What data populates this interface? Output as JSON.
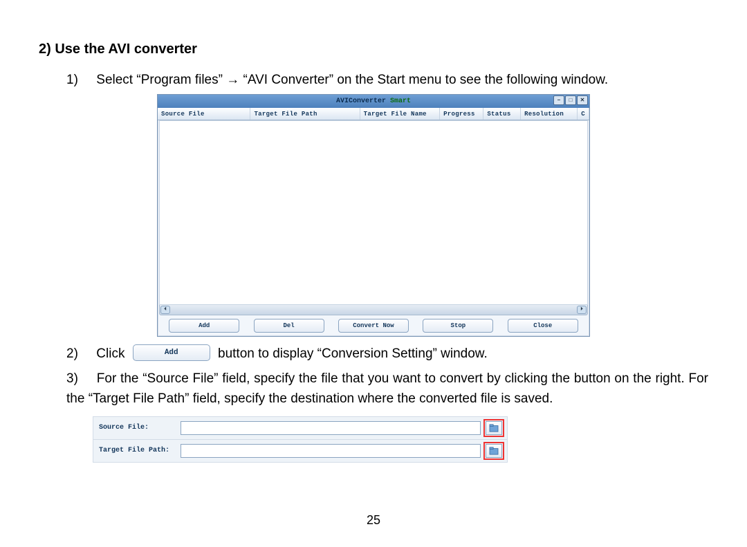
{
  "heading": "2) Use the AVI converter",
  "steps": {
    "s1_num": "1)",
    "s1_text": "Select “Program files” → “AVI Converter” on the Start menu to see the following window.",
    "s2_num": "2)",
    "s2_a": "Click",
    "s2_btn": "Add",
    "s2_b": "button to display “Conversion Setting” window.",
    "s3_num": "3)",
    "s3_text": "For the “Source File” field, specify the file that you want to convert by clicking the button on the right. For the “Target File Path” field, specify the destination where the converted file is saved."
  },
  "app": {
    "title_a": "AVIConverter",
    "title_b": " Smart",
    "min": "–",
    "max": "□",
    "close": "✕",
    "cols": {
      "c1": "Source File",
      "c2": "Target File Path",
      "c3": "Target File Name",
      "c4": "Progress",
      "c5": "Status",
      "c6": "Resolution",
      "c7": "C"
    },
    "buttons": {
      "add": "Add",
      "del": "Del",
      "convert": "Convert Now",
      "stop": "Stop",
      "close": "Close"
    },
    "scroll_l": "⏴",
    "scroll_r": "⏵"
  },
  "fields": {
    "source_label": "Source File:",
    "target_label": "Target File Path:"
  },
  "page_number": "25"
}
